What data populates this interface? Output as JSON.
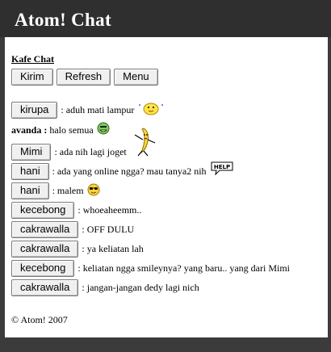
{
  "app": {
    "title": "Atom! Chat"
  },
  "room": {
    "name": "Kafe Chat"
  },
  "toolbar": {
    "send": "Kirim",
    "refresh": "Refresh",
    "menu": "Menu"
  },
  "messages": [
    {
      "nick": "kirupa",
      "text": "aduh mati lampur",
      "icon": "chick-icon"
    },
    {
      "nick": "avanda",
      "text": "halo semua",
      "icon": "grin-icon"
    },
    {
      "nick": "Mimi",
      "text": "ada nih lagi joget",
      "icon": "dancing-banana-icon"
    },
    {
      "nick": "hani",
      "text": "ada yang online ngga? mau tanya2 nih",
      "icon": "help-bubble-icon",
      "icon_text": "HELP"
    },
    {
      "nick": "hani",
      "text": "malem",
      "icon": "cool-sunglasses-icon"
    },
    {
      "nick": "kecebong",
      "text": "whoeaheemm.."
    },
    {
      "nick": "cakrawalla",
      "text": "OFF DULU"
    },
    {
      "nick": "cakrawalla",
      "text": "ya keliatan lah"
    },
    {
      "nick": "kecebong",
      "text": "keliatan ngga smileynya? yang baru.. yang dari Mimi"
    },
    {
      "nick": "cakrawalla",
      "text": "jangan-jangan dedy lagi nich"
    }
  ],
  "footer": {
    "copyright": "© Atom! 2007"
  },
  "colors": {
    "header_bg": "#2f2f2f",
    "header_text": "#ffffff",
    "frame": "#3b3b3b"
  }
}
